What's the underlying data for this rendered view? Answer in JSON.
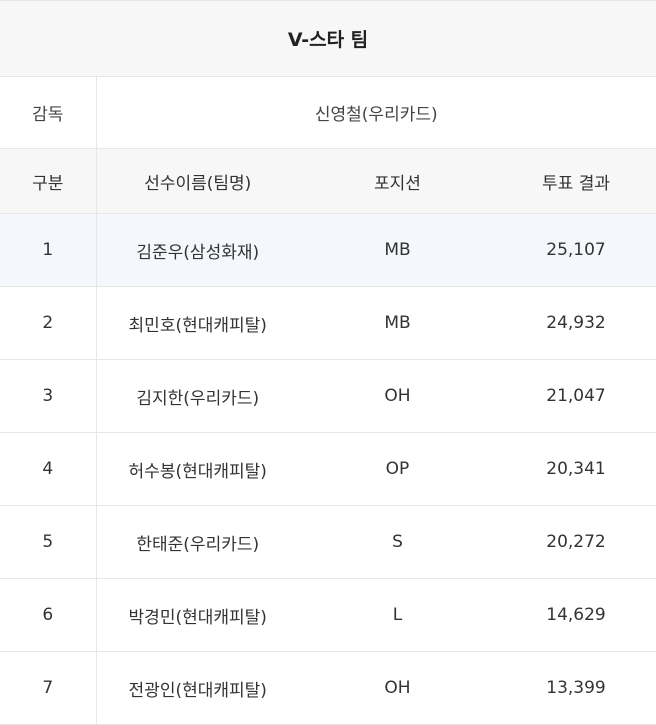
{
  "title": "V-스타 팀",
  "coach": {
    "label": "감독",
    "value": "신영철(우리카드)"
  },
  "columns": [
    "구분",
    "선수이름(팀명)",
    "포지션",
    "투표 결과"
  ],
  "rows": [
    {
      "rank": "1",
      "name": "김준우(삼성화재)",
      "position": "MB",
      "votes": "25,107"
    },
    {
      "rank": "2",
      "name": "최민호(현대캐피탈)",
      "position": "MB",
      "votes": "24,932"
    },
    {
      "rank": "3",
      "name": "김지한(우리카드)",
      "position": "OH",
      "votes": "21,047"
    },
    {
      "rank": "4",
      "name": "허수봉(현대캐피탈)",
      "position": "OP",
      "votes": "20,341"
    },
    {
      "rank": "5",
      "name": "한태준(우리카드)",
      "position": "S",
      "votes": "20,272"
    },
    {
      "rank": "6",
      "name": "박경민(현대캐피탈)",
      "position": "L",
      "votes": "14,629"
    },
    {
      "rank": "7",
      "name": "전광인(현대캐피탈)",
      "position": "OH",
      "votes": "13,399"
    }
  ],
  "colors": {
    "header_bg": "#f7f7f7",
    "highlight_bg": "#f4f8fd",
    "border": "#e6e6e6"
  }
}
